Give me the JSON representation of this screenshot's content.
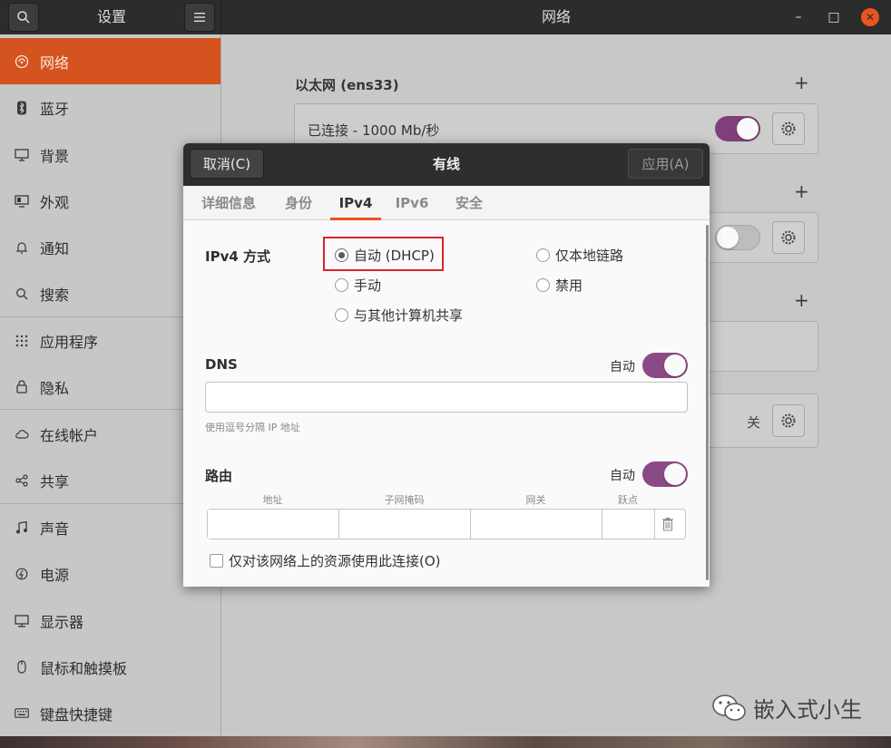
{
  "window": {
    "sidebar_title": "设置",
    "main_title": "网络",
    "minimize": "–",
    "maximize": "□",
    "close": "✕"
  },
  "sidebar": {
    "items": [
      {
        "label": "网络",
        "icon": "network-icon",
        "active": true
      },
      {
        "label": "蓝牙",
        "icon": "bluetooth-icon"
      },
      {
        "label": "背景",
        "icon": "background-icon"
      },
      {
        "label": "外观",
        "icon": "appearance-icon"
      },
      {
        "label": "通知",
        "icon": "bell-icon"
      },
      {
        "label": "搜索",
        "icon": "search-icon"
      },
      {
        "label": "应用程序",
        "icon": "apps-grid-icon"
      },
      {
        "label": "隐私",
        "icon": "lock-icon"
      },
      {
        "label": "在线帐户",
        "icon": "cloud-icon"
      },
      {
        "label": "共享",
        "icon": "share-icon"
      },
      {
        "label": "声音",
        "icon": "music-note-icon"
      },
      {
        "label": "电源",
        "icon": "power-icon"
      },
      {
        "label": "显示器",
        "icon": "display-icon"
      },
      {
        "label": "鼠标和触摸板",
        "icon": "mouse-icon"
      },
      {
        "label": "键盘快捷键",
        "icon": "keyboard-icon"
      }
    ]
  },
  "main": {
    "ethernet_title": "以太网 (ens33)",
    "ethernet_status": "已连接 - 1000 Mb/秒",
    "proxy_status": "关"
  },
  "dialog": {
    "cancel": "取消(C)",
    "title": "有线",
    "apply": "应用(A)",
    "tabs": [
      "详细信息",
      "身份",
      "IPv4",
      "IPv6",
      "安全"
    ],
    "active_tab": "IPv4",
    "ipv4_method_label": "IPv4 方式",
    "methods": {
      "auto": "自动 (DHCP)",
      "link_local": "仅本地链路",
      "manual": "手动",
      "disabled": "禁用",
      "shared": "与其他计算机共享"
    },
    "selected_method": "auto",
    "dns_label": "DNS",
    "dns_auto_label": "自动",
    "dns_value": "",
    "dns_hint": "使用逗号分隔 IP 地址",
    "routes_label": "路由",
    "routes_auto_label": "自动",
    "route_columns": [
      "地址",
      "子网掩码",
      "网关",
      "跃点"
    ],
    "only_local_label": "仅对该网络上的资源使用此连接(O)"
  },
  "watermark": "嵌入式小生",
  "colors": {
    "accent": "#e95420",
    "sidebar_active": "#d4531e",
    "toggle_on": "#8a4a86",
    "titlebar": "#2c2c2c"
  }
}
